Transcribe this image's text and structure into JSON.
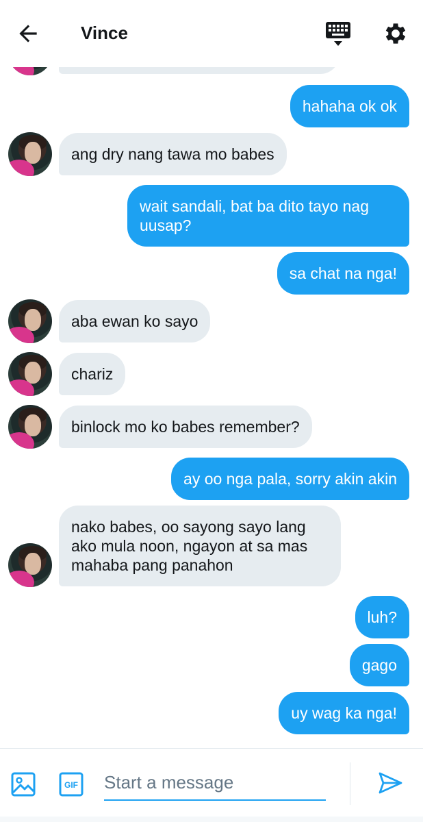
{
  "header": {
    "title": "Vince",
    "back_icon": "arrow-left-icon",
    "keyboard_icon": "keyboard-icon",
    "settings_icon": "gear-icon"
  },
  "colors": {
    "accent": "#1da1f2",
    "incoming_bubble": "#e6ecf0",
    "text": "#14171a",
    "muted": "#657786"
  },
  "messages": [
    {
      "dir": "in",
      "text": ""
    },
    {
      "dir": "out",
      "text": "hahaha ok ok"
    },
    {
      "dir": "in",
      "text": "ang dry nang tawa mo babes"
    },
    {
      "dir": "out",
      "text": "wait sandali, bat ba dito tayo nag uusap?"
    },
    {
      "dir": "out",
      "text": "sa chat na nga!"
    },
    {
      "dir": "in",
      "text": "aba ewan ko sayo"
    },
    {
      "dir": "in",
      "text": "chariz"
    },
    {
      "dir": "in",
      "text": "binlock mo ko babes remember?"
    },
    {
      "dir": "out",
      "text": "ay oo nga pala, sorry akin akin"
    },
    {
      "dir": "in",
      "text": "nako babes, oo sayong sayo lang ako mula noon, ngayon at sa mas mahaba pang panahon"
    },
    {
      "dir": "out",
      "text": "luh?"
    },
    {
      "dir": "out",
      "text": "gago"
    },
    {
      "dir": "out",
      "text": "uy wag ka nga!"
    }
  ],
  "composer": {
    "placeholder": "Start a message",
    "image_icon": "image-icon",
    "gif_icon": "gif-icon",
    "gif_label": "GIF",
    "send_icon": "send-icon"
  }
}
